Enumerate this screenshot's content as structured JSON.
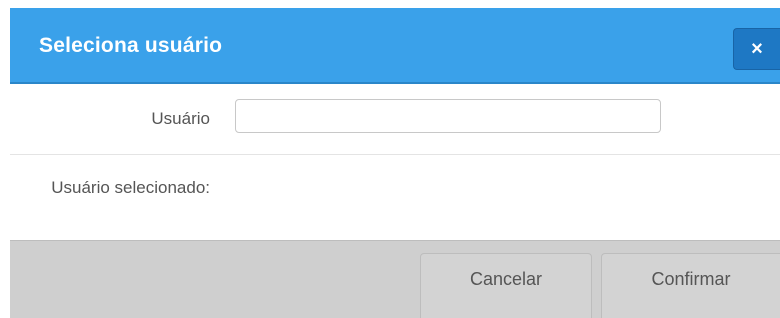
{
  "dialog": {
    "title": "Seleciona usuário",
    "close_label": "×"
  },
  "form": {
    "user_label": "Usuário",
    "user_value": "",
    "user_placeholder": "",
    "selected_label": "Usuário selecionado:",
    "selected_value": ""
  },
  "footer": {
    "cancel_label": "Cancelar",
    "confirm_label": "Confirmar"
  },
  "colors": {
    "header": "#3aa1ea",
    "close_button": "#1e78c4",
    "footer": "#cfcfcf"
  }
}
